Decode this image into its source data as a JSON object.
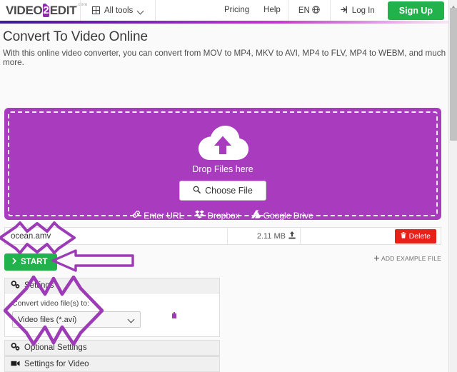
{
  "header": {
    "logo": {
      "part1": "VIDEO",
      "badge": "2",
      "part2": "EDIT",
      "domain": ".com"
    },
    "all_tools": "All tools",
    "links": [
      {
        "label": "Pricing"
      },
      {
        "label": "Help"
      }
    ],
    "language": "EN",
    "login": "Log In",
    "signup": "Sign Up"
  },
  "page": {
    "title": "Convert To Video Online",
    "subtitle": "With this online video converter, you can convert from MOV to MP4, MKV to AVI, MP4 to FLV, MP4 to WEBM, and much more."
  },
  "dropzone": {
    "label": "Drop Files here",
    "choose_file": "Choose File",
    "links": [
      {
        "label": "Enter URL",
        "icon": "link-icon"
      },
      {
        "label": "Dropbox",
        "icon": "dropbox-icon"
      },
      {
        "label": "Google Drive",
        "icon": "google-drive-icon"
      }
    ]
  },
  "file_row": {
    "name": "ocean.amv",
    "size": "2.11 MB",
    "delete": "Delete"
  },
  "actions": {
    "start": "START",
    "add_example": "ADD EXAMPLE FILE"
  },
  "panels": [
    {
      "title": "Settings",
      "icon": "gears-icon"
    },
    {
      "title": "Optional Settings",
      "icon": "gears-icon"
    },
    {
      "title": "Settings for Video",
      "icon": "video-camera-icon"
    }
  ],
  "settings": {
    "convert_label": "Convert video file(s) to:",
    "format_value": "Video files (*.avi)"
  },
  "colors": {
    "brand_purple": "#a93cbe",
    "green": "#22b24c",
    "red": "#e8201a",
    "annotation_purple": "#9c3bb5"
  }
}
